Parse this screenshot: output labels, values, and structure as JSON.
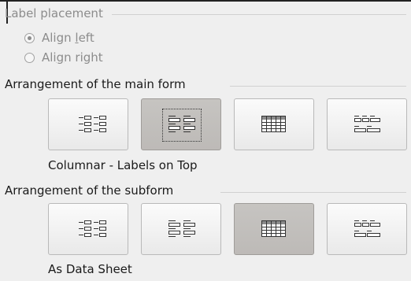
{
  "label_placement": {
    "title": "Label placement",
    "options": [
      {
        "label_pre": "Align ",
        "label_u": "l",
        "label_post": "eft",
        "checked": true
      },
      {
        "label_pre": "Ali",
        "label_u": "g",
        "label_post": "n right",
        "checked": false
      }
    ]
  },
  "main_form": {
    "title": "Arrangement of the main form",
    "layouts": [
      {
        "name": "columnar-labels-left",
        "icon": "columnar-labels-left-icon",
        "selected": false
      },
      {
        "name": "columnar-labels-on-top",
        "icon": "columnar-labels-on-top-icon",
        "selected": true
      },
      {
        "name": "as-data-sheet",
        "icon": "data-sheet-icon",
        "selected": false
      },
      {
        "name": "in-blocks-labels-above",
        "icon": "blocks-labels-above-icon",
        "selected": false
      }
    ],
    "selected_caption": "Columnar - Labels on Top"
  },
  "sub_form": {
    "title": "Arrangement of the subform",
    "layouts": [
      {
        "name": "columnar-labels-left",
        "icon": "columnar-labels-left-icon",
        "selected": false
      },
      {
        "name": "columnar-labels-on-top",
        "icon": "columnar-labels-on-top-icon",
        "selected": false
      },
      {
        "name": "as-data-sheet",
        "icon": "data-sheet-icon",
        "selected": true
      },
      {
        "name": "in-blocks-labels-above",
        "icon": "blocks-labels-above-icon",
        "selected": false
      }
    ],
    "selected_caption": "As Data Sheet"
  }
}
